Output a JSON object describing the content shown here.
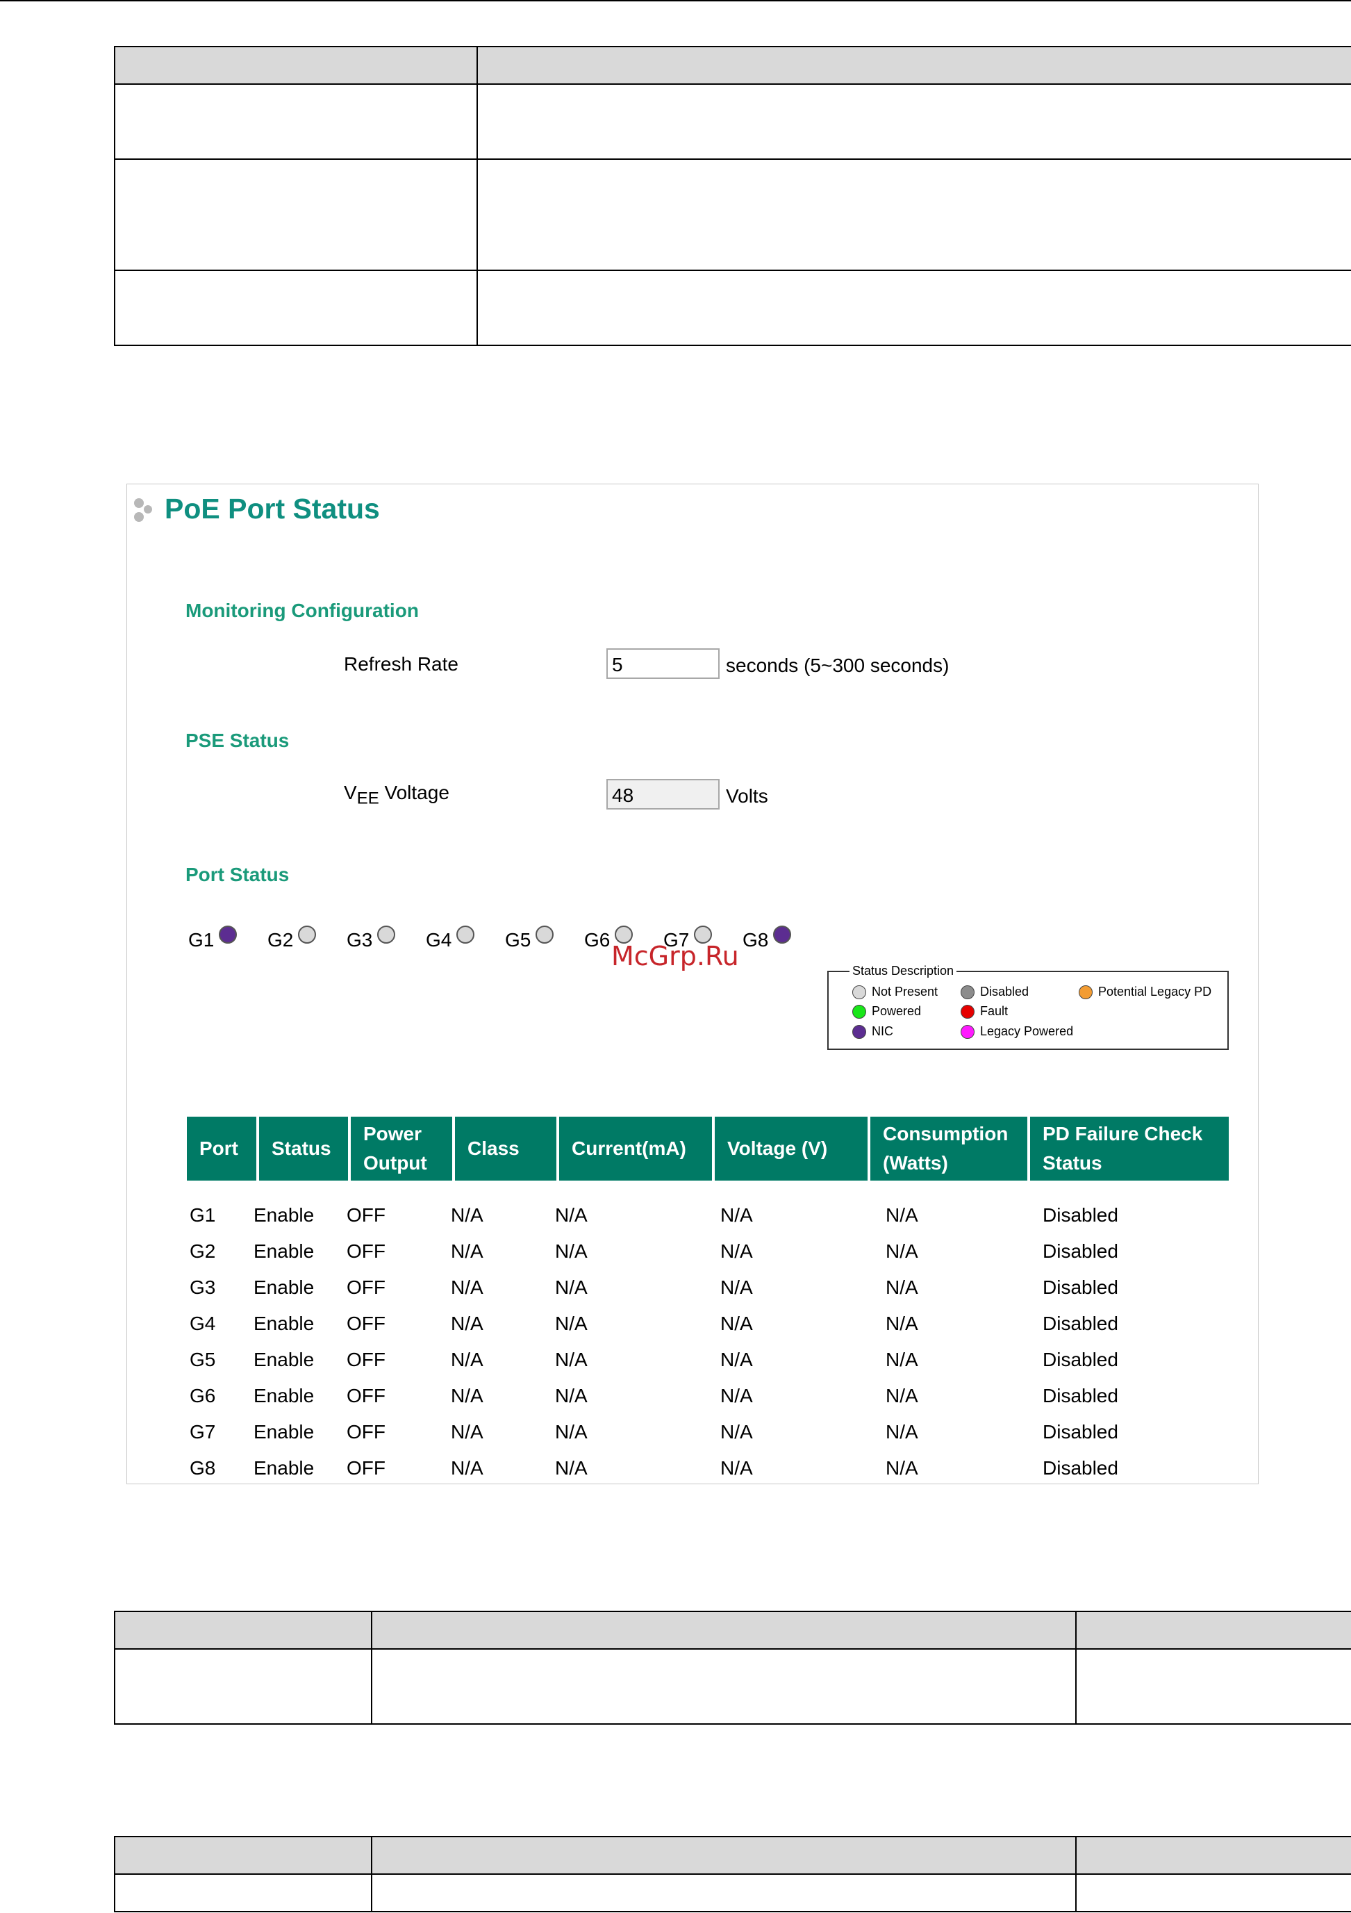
{
  "panel": {
    "title": "PoE Port Status",
    "monitoring": {
      "heading": "Monitoring Configuration",
      "refresh_label": "Refresh Rate",
      "refresh_value": "5",
      "refresh_unit": "seconds (5~300 seconds)"
    },
    "pse": {
      "heading": "PSE Status",
      "vee_prefix": "V",
      "vee_sub": "EE",
      "vee_suffix": " Voltage",
      "vee_value": "48",
      "vee_unit": "Volts"
    },
    "port_status": {
      "heading": "Port Status",
      "ports": [
        {
          "name": "G1",
          "state": "NIC"
        },
        {
          "name": "G2",
          "state": "Not Present"
        },
        {
          "name": "G3",
          "state": "Not Present"
        },
        {
          "name": "G4",
          "state": "Not Present"
        },
        {
          "name": "G5",
          "state": "Not Present"
        },
        {
          "name": "G6",
          "state": "Not Present"
        },
        {
          "name": "G7",
          "state": "Not Present"
        },
        {
          "name": "G8",
          "state": "NIC"
        }
      ]
    },
    "legend": {
      "title": "Status Description",
      "items": [
        {
          "label": "Not Present",
          "color": "#d9d9d9"
        },
        {
          "label": "Disabled",
          "color": "#8c8c8c"
        },
        {
          "label": "Potential Legacy PD",
          "color": "#f39c32"
        },
        {
          "label": "Powered",
          "color": "#19e619"
        },
        {
          "label": "Fault",
          "color": "#e60000"
        },
        {
          "label": "NIC",
          "color": "#5c2d91"
        },
        {
          "label": "Legacy Powered",
          "color": "#ff19ff"
        }
      ]
    },
    "table": {
      "headers": [
        "Port",
        "Status",
        "Power Output",
        "Class",
        "Current(mA)",
        "Voltage (V)",
        "Consumption (Watts)",
        "PD Failure Check Status"
      ],
      "rows": [
        [
          "G1",
          "Enable",
          "OFF",
          "N/A",
          "N/A",
          "N/A",
          "N/A",
          "Disabled"
        ],
        [
          "G2",
          "Enable",
          "OFF",
          "N/A",
          "N/A",
          "N/A",
          "N/A",
          "Disabled"
        ],
        [
          "G3",
          "Enable",
          "OFF",
          "N/A",
          "N/A",
          "N/A",
          "N/A",
          "Disabled"
        ],
        [
          "G4",
          "Enable",
          "OFF",
          "N/A",
          "N/A",
          "N/A",
          "N/A",
          "Disabled"
        ],
        [
          "G5",
          "Enable",
          "OFF",
          "N/A",
          "N/A",
          "N/A",
          "N/A",
          "Disabled"
        ],
        [
          "G6",
          "Enable",
          "OFF",
          "N/A",
          "N/A",
          "N/A",
          "N/A",
          "Disabled"
        ],
        [
          "G7",
          "Enable",
          "OFF",
          "N/A",
          "N/A",
          "N/A",
          "N/A",
          "Disabled"
        ],
        [
          "G8",
          "Enable",
          "OFF",
          "N/A",
          "N/A",
          "N/A",
          "N/A",
          "Disabled"
        ]
      ]
    }
  },
  "watermark": "McGrp.Ru",
  "colors": {
    "accent": "#0f8f80",
    "section": "#1a9a7a",
    "header_bg": "#007a65",
    "nic": "#5c2d91",
    "not_present": "#d9d9d9"
  }
}
